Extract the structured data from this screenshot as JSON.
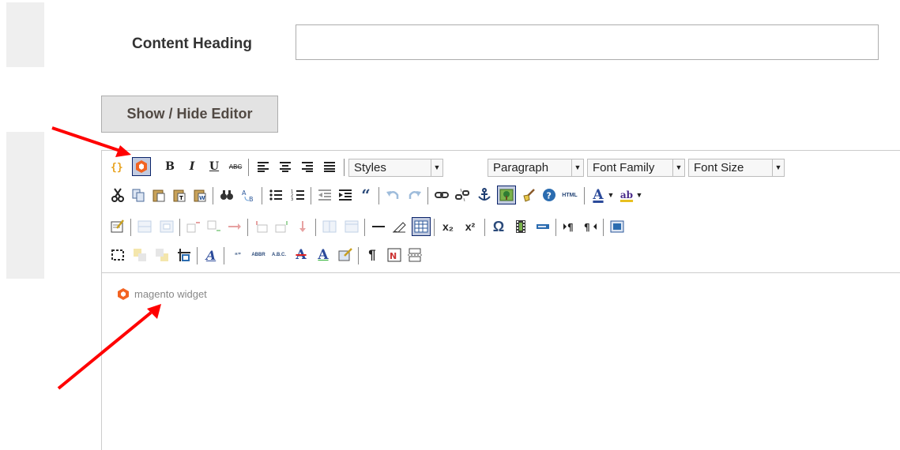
{
  "form": {
    "content_heading_label": "Content Heading",
    "content_heading_value": "",
    "toggle_editor_label": "Show / Hide Editor"
  },
  "toolbar": {
    "dropdowns": {
      "styles": "Styles",
      "paragraph": "Paragraph",
      "font_family": "Font Family",
      "font_size": "Font Size"
    },
    "glyphs": {
      "bold": "B",
      "italic": "I",
      "underline": "U",
      "strike": "ABC",
      "blockquote": "“",
      "html": "HTML",
      "text_color": "A",
      "background_color": "ab",
      "subscript": "x₂",
      "superscript": "x²",
      "special_char": "Ω",
      "pilcrow": "¶",
      "cite": "“”",
      "abbr": "ABBR",
      "acronym": "A.B.C.",
      "del": "A",
      "ins": "A",
      "style_props": "A"
    }
  },
  "content": {
    "widget_label": "magento widget"
  },
  "colors": {
    "accent_red": "#ff0000",
    "magento_orange": "#f26322",
    "button_bg": "#e3e3e3"
  }
}
